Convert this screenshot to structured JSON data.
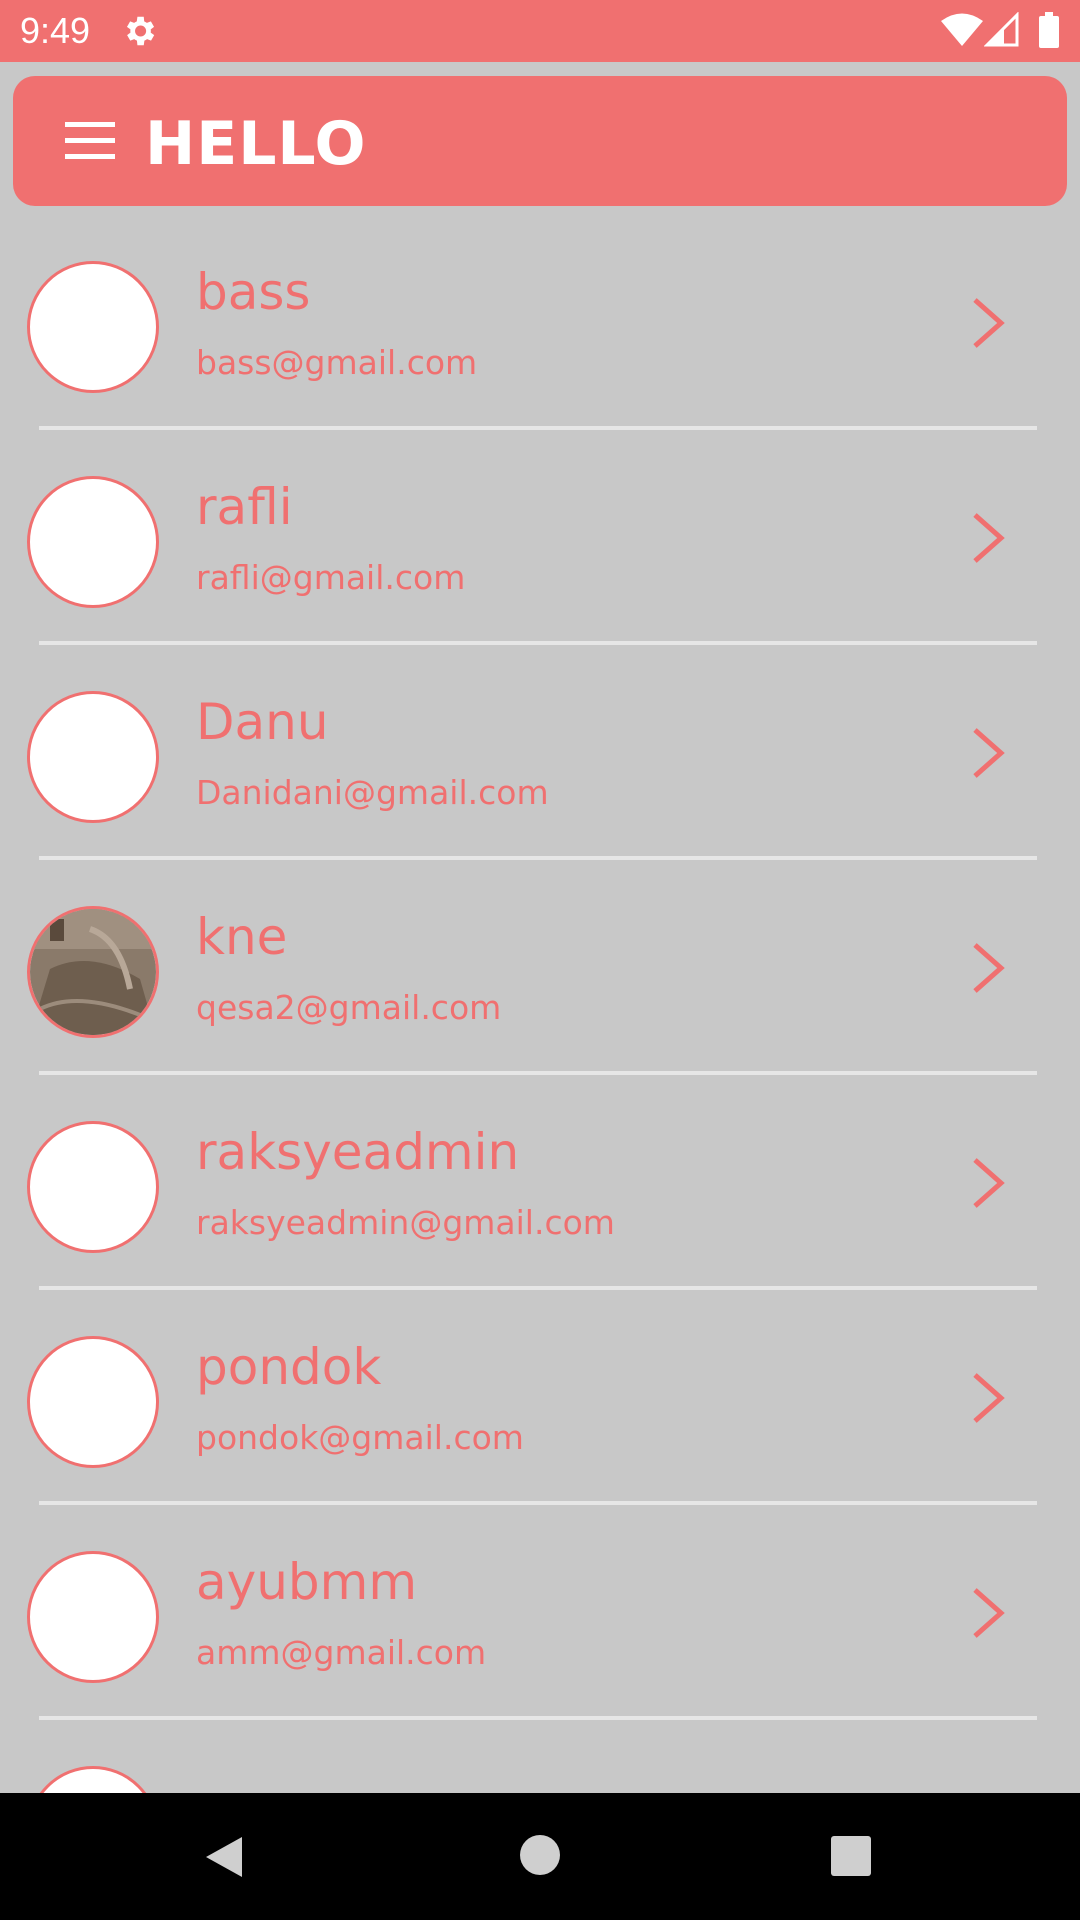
{
  "status_bar": {
    "time": "9:49",
    "icons": [
      "gear-icon",
      "wifi-icon",
      "signal-icon",
      "battery-icon"
    ]
  },
  "app_bar": {
    "title": "HELLO",
    "menu_icon": "hamburger-menu-icon"
  },
  "colors": {
    "accent": "#f07070",
    "background": "#c8c8c8",
    "divider": "#e6e6e6",
    "avatar_fill": "#ffffff"
  },
  "users": [
    {
      "name": "bass",
      "email": "bass@gmail.com",
      "avatar": "blank"
    },
    {
      "name": "rafli",
      "email": "rafli@gmail.com",
      "avatar": "blank"
    },
    {
      "name": "Danu",
      "email": "Danidani@gmail.com",
      "avatar": "blank"
    },
    {
      "name": "kne",
      "email": "qesa2@gmail.com",
      "avatar": "photo"
    },
    {
      "name": "raksyeadmin",
      "email": "raksyeadmin@gmail.com",
      "avatar": "blank"
    },
    {
      "name": "pondok",
      "email": "pondok@gmail.com",
      "avatar": "blank"
    },
    {
      "name": "ayubmm",
      "email": "amm@gmail.com",
      "avatar": "blank"
    }
  ],
  "nav_bar": {
    "buttons": [
      "back-icon",
      "home-icon",
      "recents-icon"
    ]
  }
}
